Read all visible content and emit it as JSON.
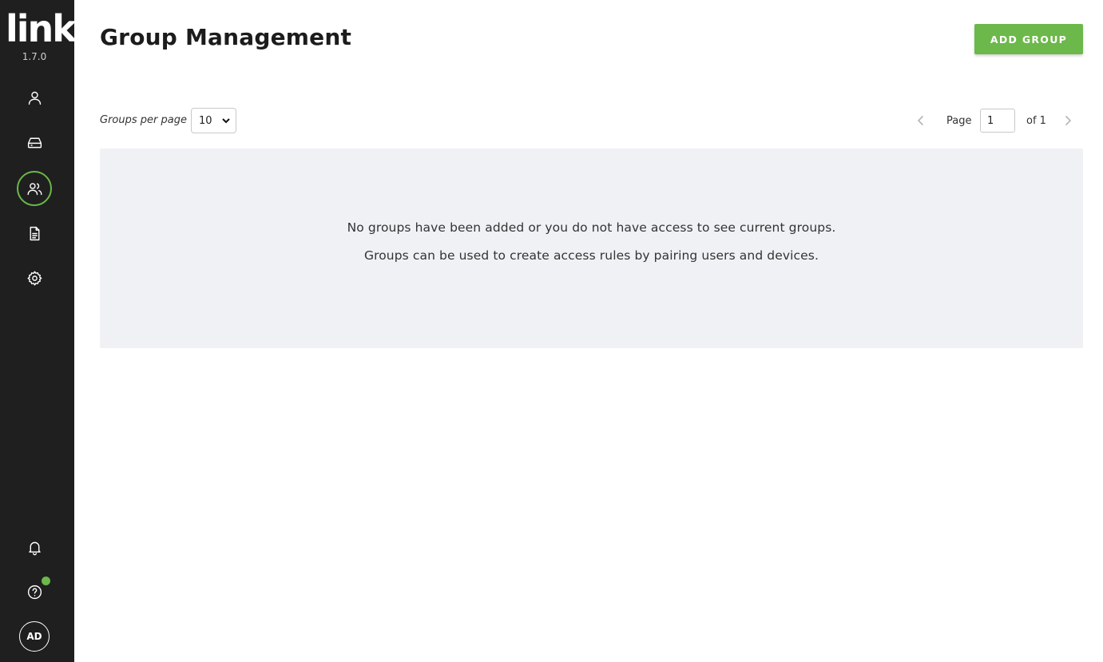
{
  "app": {
    "logo_text": "link",
    "version": "1.7.0"
  },
  "sidebar": {
    "items": [
      {
        "icon": "user-icon",
        "active": false
      },
      {
        "icon": "device-icon",
        "active": false
      },
      {
        "icon": "users-group-icon",
        "active": true
      },
      {
        "icon": "document-icon",
        "active": false
      },
      {
        "icon": "gear-icon",
        "active": false
      }
    ],
    "bottom": [
      {
        "icon": "bell-icon"
      },
      {
        "icon": "help-icon",
        "badge_color": "#6cb84a"
      }
    ],
    "avatar_initials": "AD"
  },
  "header": {
    "title": "Group Management",
    "add_button_label": "ADD GROUP"
  },
  "pagination": {
    "per_page_label": "Groups per page",
    "per_page_value": "10",
    "page_label": "Page",
    "current_page": "1",
    "of_label": "of 1"
  },
  "empty_state": {
    "line1": "No groups have been added or you do not have access to see current groups.",
    "line2": "Groups can be used to create access rules by pairing users and devices."
  },
  "colors": {
    "accent": "#6cb84a",
    "sidebar_bg": "#1f1f1f",
    "panel_bg": "#f0f1f5"
  }
}
